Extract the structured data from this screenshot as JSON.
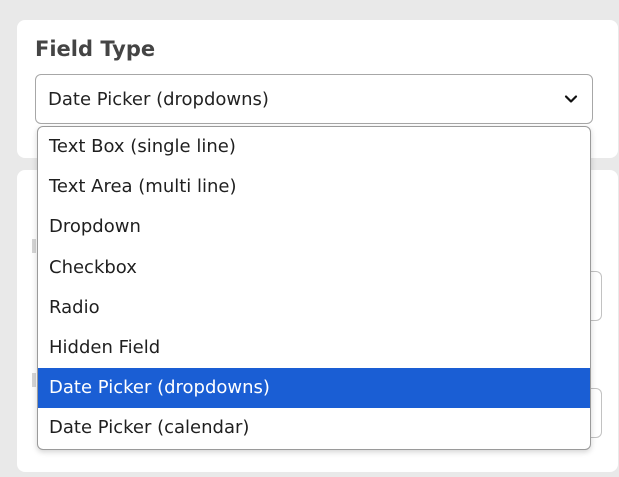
{
  "field_type": {
    "title": "Field Type",
    "selected_value": "Date Picker (dropdowns)",
    "selected_index": 6,
    "options": [
      "Text Box (single line)",
      "Text Area (multi line)",
      "Dropdown",
      "Checkbox",
      "Radio",
      "Hidden Field",
      "Date Picker (dropdowns)",
      "Date Picker (calendar)"
    ]
  },
  "icons": {
    "select_arrow": "chevron-down-icon"
  },
  "colors": {
    "background": "#e9e9e9",
    "card": "#ffffff",
    "highlight": "#1a5ed4",
    "highlight_text": "#ffffff"
  }
}
